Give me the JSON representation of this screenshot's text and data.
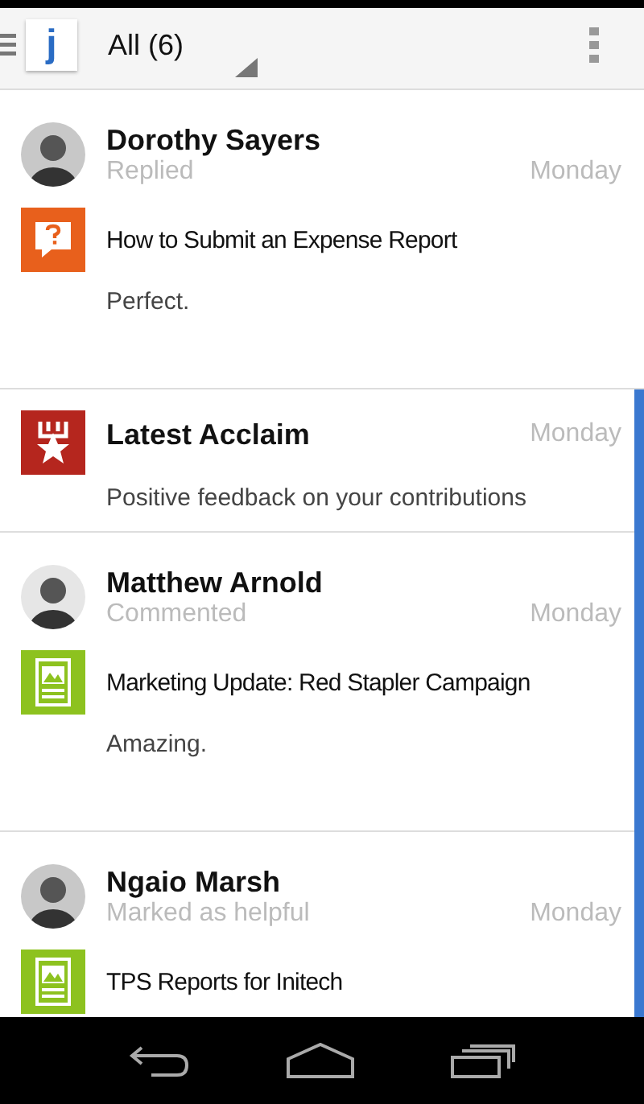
{
  "header": {
    "logo": "j",
    "title": "All (6)"
  },
  "items": [
    {
      "kind": "activity",
      "unread": false,
      "person": "Dorothy Sayers",
      "action": "Replied",
      "date": "Monday",
      "icon": {
        "kind": "question"
      },
      "content_title": "How to Submit an Expense Report",
      "body": "Perfect."
    },
    {
      "kind": "notification",
      "unread": true,
      "icon": {
        "kind": "acclaim"
      },
      "title": "Latest Acclaim",
      "date": "Monday",
      "body": "Positive feedback on your contributions"
    },
    {
      "kind": "activity",
      "unread": true,
      "person": "Matthew Arnold",
      "action": "Commented",
      "date": "Monday",
      "icon": {
        "kind": "document"
      },
      "content_title": "Marketing Update: Red Stapler Campaign",
      "body": "Amazing."
    },
    {
      "kind": "activity",
      "unread": true,
      "person": "Ngaio Marsh",
      "action": "Marked as helpful",
      "date": "Monday",
      "icon": {
        "kind": "document"
      },
      "content_title": "TPS Reports for Initech"
    }
  ]
}
